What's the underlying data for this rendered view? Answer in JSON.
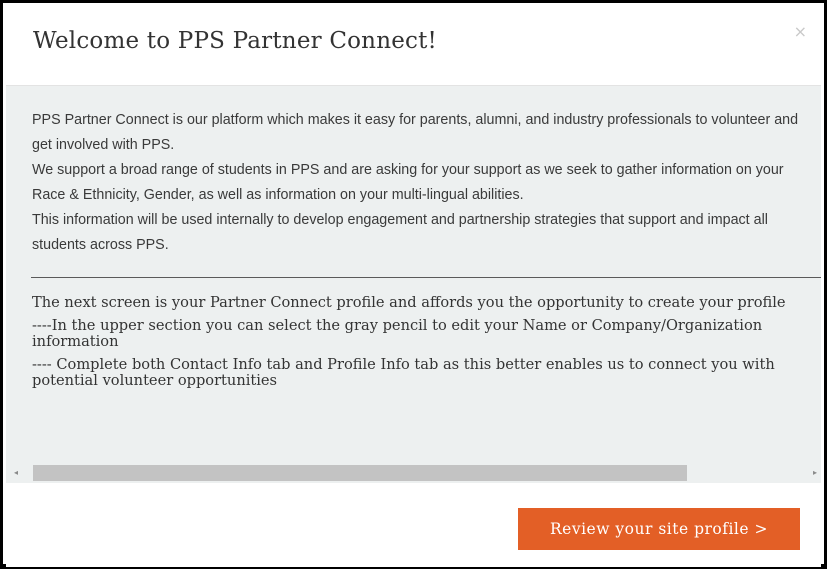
{
  "modal": {
    "title": "Welcome to PPS Partner Connect!",
    "close_label": "×",
    "intro": [
      "PPS Partner Connect is our platform which makes it easy for parents, alumni, and industry professionals to volunteer and get involved with PPS.",
      "We support a broad range of students in PPS and are asking for your support as we seek to gather information on your Race & Ethnicity, Gender, as well as information on your multi-lingual abilities.",
      "This information will be used internally to develop engagement and partnership strategies that support and impact all students across PPS."
    ],
    "guide": [
      "The next screen is your Partner Connect profile and affords you the opportunity to create your profile",
      "----In the upper section you can select the gray pencil to edit your Name or Company/Organization information",
      "---- Complete both Contact Info tab and Profile Info tab as this better enables us to connect you with potential volunteer opportunities"
    ],
    "scrollbar": {
      "left_arrow": "◂",
      "right_arrow": "▸"
    },
    "footer": {
      "review_button_label": "Review your site profile >"
    }
  },
  "colors": {
    "accent": "#e35f26",
    "body_background": "#edf0f0",
    "scroll_thumb": "#c3c3c3"
  },
  "icons": {
    "close": "close-icon",
    "scroll_left": "scroll-left-arrow-icon",
    "scroll_right": "scroll-right-arrow-icon"
  }
}
